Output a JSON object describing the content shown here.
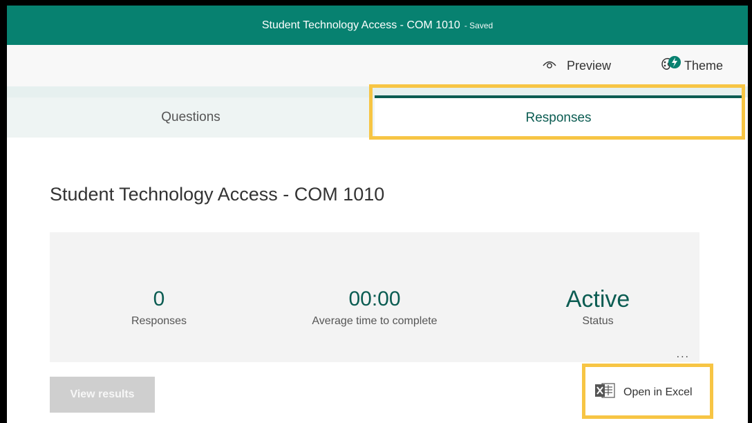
{
  "header": {
    "title": "Student Technology Access - COM 1010",
    "save_status": "- Saved",
    "accent_color": "#078170"
  },
  "toolbar": {
    "preview_label": "Preview",
    "theme_label": "Theme"
  },
  "tabs": [
    {
      "label": "Questions",
      "selected": false
    },
    {
      "label": "Responses",
      "selected": true
    }
  ],
  "main": {
    "form_title": "Student Technology Access - COM 1010",
    "summary": {
      "responses_value": "0",
      "responses_label": "Responses",
      "avg_time_value": "00:00",
      "avg_time_label": "Average time to complete",
      "status_value": "Active",
      "status_label": "Status",
      "more_label": "..."
    },
    "view_results_label": "View results",
    "open_excel_label": "Open in Excel"
  },
  "icons": {
    "preview": "eye-icon",
    "theme": "palette-icon",
    "excel": "excel-icon"
  },
  "highlight_color": "#f7c544"
}
